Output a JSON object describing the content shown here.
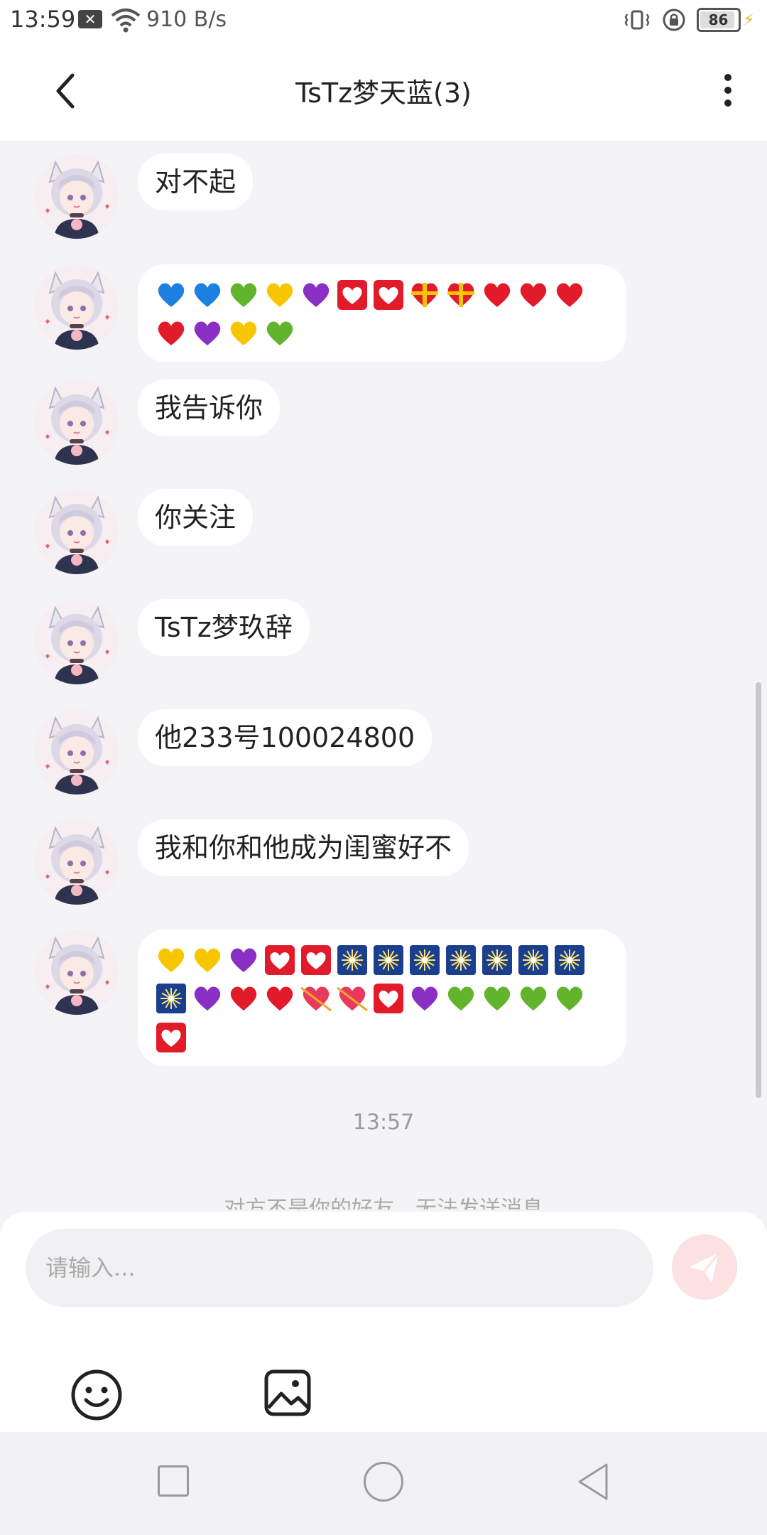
{
  "status_bar": {
    "time": "13:59",
    "speed": "910 B/s",
    "battery": "86",
    "battery_level": 0.86
  },
  "header": {
    "title": "TsTz梦天蓝(3)"
  },
  "messages": [
    {
      "type": "text",
      "text": "对不起"
    },
    {
      "type": "emoji",
      "emojis": [
        "blue-heart",
        "blue-heart",
        "green-heart",
        "yellow-heart",
        "purple-heart",
        "heart-box",
        "heart-box",
        "gift-heart",
        "gift-heart",
        "red-heart",
        "red-heart",
        "red-heart",
        "red-heart",
        "purple-heart",
        "yellow-heart",
        "green-heart"
      ]
    },
    {
      "type": "text",
      "text": "我告诉你"
    },
    {
      "type": "text",
      "text": "你关注"
    },
    {
      "type": "text",
      "text": "TsTz梦玖辞"
    },
    {
      "type": "text",
      "text": "他233号100024800"
    },
    {
      "type": "text",
      "text": "我和你和他成为闺蜜好不"
    },
    {
      "type": "emoji",
      "emojis": [
        "yellow-heart",
        "yellow-heart",
        "purple-heart",
        "heart-box",
        "heart-box",
        "firework",
        "firework",
        "firework",
        "firework",
        "firework",
        "firework",
        "firework",
        "firework",
        "purple-heart",
        "red-heart",
        "red-heart",
        "arrow-heart",
        "arrow-heart",
        "heart-box",
        "purple-heart",
        "green-heart",
        "green-heart",
        "green-heart",
        "green-heart",
        "heart-box"
      ]
    }
  ],
  "timestamp": "13:57",
  "notice": "对方不是你的好友，无法发送消息",
  "composer": {
    "placeholder": "请输入..."
  },
  "colors": {
    "background": "#f4f4f6",
    "bubble": "#ffffff",
    "send_button": "#fbe1df"
  }
}
